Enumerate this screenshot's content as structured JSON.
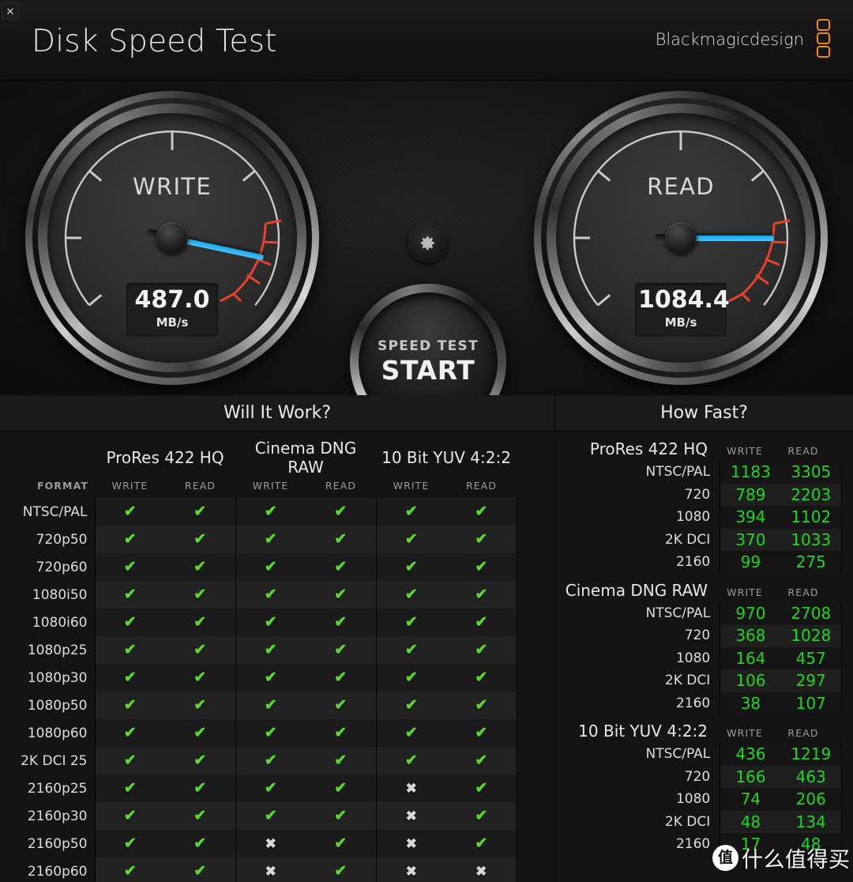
{
  "window": {
    "close_label": "✕"
  },
  "header": {
    "title": "Disk Speed Test",
    "brand": "Blackmagicdesign",
    "brand_color": "#ef8b11"
  },
  "gauges": {
    "write": {
      "label": "WRITE",
      "value": "487.0",
      "unit": "MB/s",
      "needle_angle_deg": 192
    },
    "read": {
      "label": "READ",
      "value": "1084.4",
      "unit": "MB/s",
      "needle_angle_deg": 180
    },
    "needle_color": "#12a5e8",
    "redzone_color": "#e8412c"
  },
  "controls": {
    "gear_icon": "gear-icon",
    "start_line1": "SPEED TEST",
    "start_line2": "START"
  },
  "will_it_work": {
    "title": "Will It Work?",
    "format_header": "FORMAT",
    "groups": [
      {
        "name": "ProRes 422 HQ",
        "write_label": "WRITE",
        "read_label": "READ"
      },
      {
        "name": "Cinema DNG RAW",
        "write_label": "WRITE",
        "read_label": "READ"
      },
      {
        "name": "10 Bit YUV 4:2:2",
        "write_label": "WRITE",
        "read_label": "READ"
      }
    ],
    "check_glyph": "✔",
    "cross_glyph": "✖",
    "rows": [
      {
        "format": "NTSC/PAL",
        "cells": [
          true,
          true,
          true,
          true,
          true,
          true
        ]
      },
      {
        "format": "720p50",
        "cells": [
          true,
          true,
          true,
          true,
          true,
          true
        ]
      },
      {
        "format": "720p60",
        "cells": [
          true,
          true,
          true,
          true,
          true,
          true
        ]
      },
      {
        "format": "1080i50",
        "cells": [
          true,
          true,
          true,
          true,
          true,
          true
        ]
      },
      {
        "format": "1080i60",
        "cells": [
          true,
          true,
          true,
          true,
          true,
          true
        ]
      },
      {
        "format": "1080p25",
        "cells": [
          true,
          true,
          true,
          true,
          true,
          true
        ]
      },
      {
        "format": "1080p30",
        "cells": [
          true,
          true,
          true,
          true,
          true,
          true
        ]
      },
      {
        "format": "1080p50",
        "cells": [
          true,
          true,
          true,
          true,
          true,
          true
        ]
      },
      {
        "format": "1080p60",
        "cells": [
          true,
          true,
          true,
          true,
          true,
          true
        ]
      },
      {
        "format": "2K DCI 25",
        "cells": [
          true,
          true,
          true,
          true,
          true,
          true
        ]
      },
      {
        "format": "2160p25",
        "cells": [
          true,
          true,
          true,
          true,
          false,
          true
        ]
      },
      {
        "format": "2160p30",
        "cells": [
          true,
          true,
          true,
          true,
          false,
          true
        ]
      },
      {
        "format": "2160p50",
        "cells": [
          true,
          true,
          false,
          true,
          false,
          true
        ]
      },
      {
        "format": "2160p60",
        "cells": [
          true,
          true,
          false,
          true,
          false,
          false
        ]
      }
    ]
  },
  "how_fast": {
    "title": "How Fast?",
    "value_color": "#22d422",
    "sections": [
      {
        "name": "ProRes 422 HQ",
        "write_label": "WRITE",
        "read_label": "READ",
        "rows": [
          {
            "format": "NTSC/PAL",
            "write": "1183",
            "read": "3305"
          },
          {
            "format": "720",
            "write": "789",
            "read": "2203"
          },
          {
            "format": "1080",
            "write": "394",
            "read": "1102"
          },
          {
            "format": "2K DCI",
            "write": "370",
            "read": "1033"
          },
          {
            "format": "2160",
            "write": "99",
            "read": "275"
          }
        ]
      },
      {
        "name": "Cinema DNG RAW",
        "write_label": "WRITE",
        "read_label": "READ",
        "rows": [
          {
            "format": "NTSC/PAL",
            "write": "970",
            "read": "2708"
          },
          {
            "format": "720",
            "write": "368",
            "read": "1028"
          },
          {
            "format": "1080",
            "write": "164",
            "read": "457"
          },
          {
            "format": "2K DCI",
            "write": "106",
            "read": "297"
          },
          {
            "format": "2160",
            "write": "38",
            "read": "107"
          }
        ]
      },
      {
        "name": "10 Bit YUV 4:2:2",
        "write_label": "WRITE",
        "read_label": "READ",
        "rows": [
          {
            "format": "NTSC/PAL",
            "write": "436",
            "read": "1219"
          },
          {
            "format": "720",
            "write": "166",
            "read": "463"
          },
          {
            "format": "1080",
            "write": "74",
            "read": "206"
          },
          {
            "format": "2K DCI",
            "write": "48",
            "read": "134"
          },
          {
            "format": "2160",
            "write": "17",
            "read": "48"
          }
        ]
      }
    ]
  },
  "watermark": {
    "mark": "值",
    "text": "什么值得买"
  }
}
